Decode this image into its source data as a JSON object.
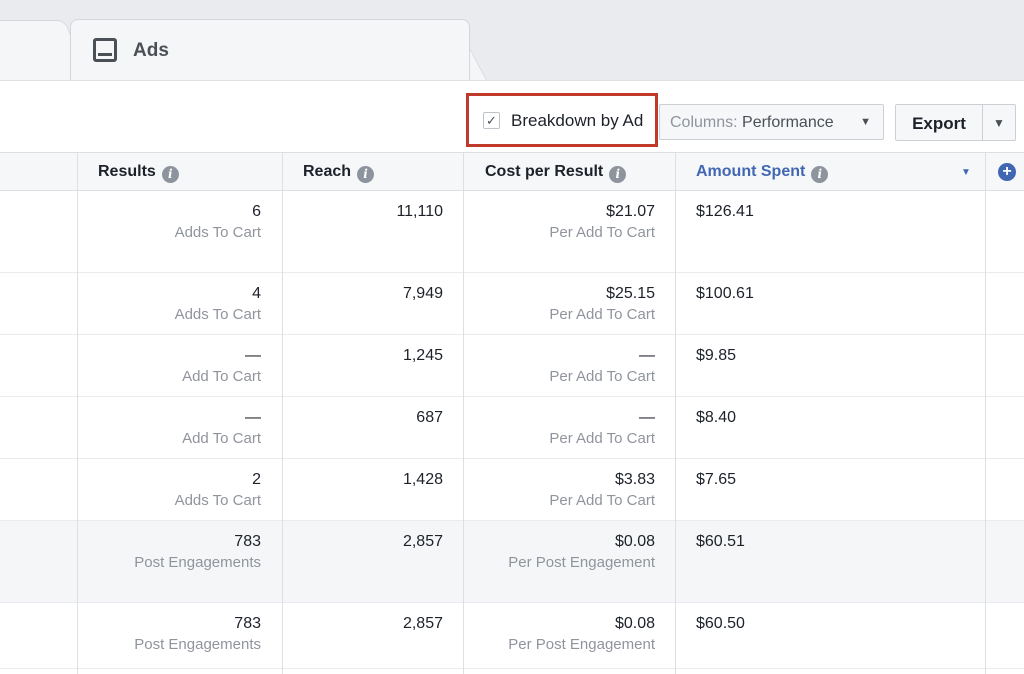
{
  "tabs": {
    "ads_label": "Ads"
  },
  "toolbar": {
    "breakdown_check": "✓",
    "breakdown_label": "Breakdown by Ad",
    "columns_label": "Columns:",
    "columns_value": "Performance",
    "export_label": "Export"
  },
  "columns": {
    "results": "Results",
    "reach": "Reach",
    "cost_per_result": "Cost per Result",
    "amount_spent": "Amount Spent"
  },
  "rows": [
    {
      "results": "6",
      "results_sub": "Adds To Cart",
      "reach": "11,110",
      "cost": "$21.07",
      "cost_sub": "Per Add To Cart",
      "spent": "$126.41",
      "shaded": false
    },
    {
      "results": "4",
      "results_sub": "Adds To Cart",
      "reach": "7,949",
      "cost": "$25.15",
      "cost_sub": "Per Add To Cart",
      "spent": "$100.61",
      "shaded": false
    },
    {
      "results": "—",
      "results_sub": "Add To Cart",
      "reach": "1,245",
      "cost": "—",
      "cost_sub": "Per Add To Cart",
      "spent": "$9.85",
      "shaded": false
    },
    {
      "results": "—",
      "results_sub": "Add To Cart",
      "reach": "687",
      "cost": "—",
      "cost_sub": "Per Add To Cart",
      "spent": "$8.40",
      "shaded": false
    },
    {
      "results": "2",
      "results_sub": "Adds To Cart",
      "reach": "1,428",
      "cost": "$3.83",
      "cost_sub": "Per Add To Cart",
      "spent": "$7.65",
      "shaded": false
    },
    {
      "results": "783",
      "results_sub": "Post Engagements",
      "reach": "2,857",
      "cost": "$0.08",
      "cost_sub": "Per Post Engagement",
      "spent": "$60.51",
      "shaded": true
    },
    {
      "results": "783",
      "results_sub": "Post Engagements",
      "reach": "2,857",
      "cost": "$0.08",
      "cost_sub": "Per Post Engagement",
      "spent": "$60.50",
      "shaded": false
    }
  ],
  "colors": {
    "accent": "#4267b2",
    "highlight_border": "#c0392b",
    "muted_text": "#90949c"
  },
  "icons": [
    "ads-tab-icon",
    "checkbox-check-icon",
    "caret-down-icon",
    "info-icon",
    "sort-caret-icon",
    "add-column-icon"
  ]
}
